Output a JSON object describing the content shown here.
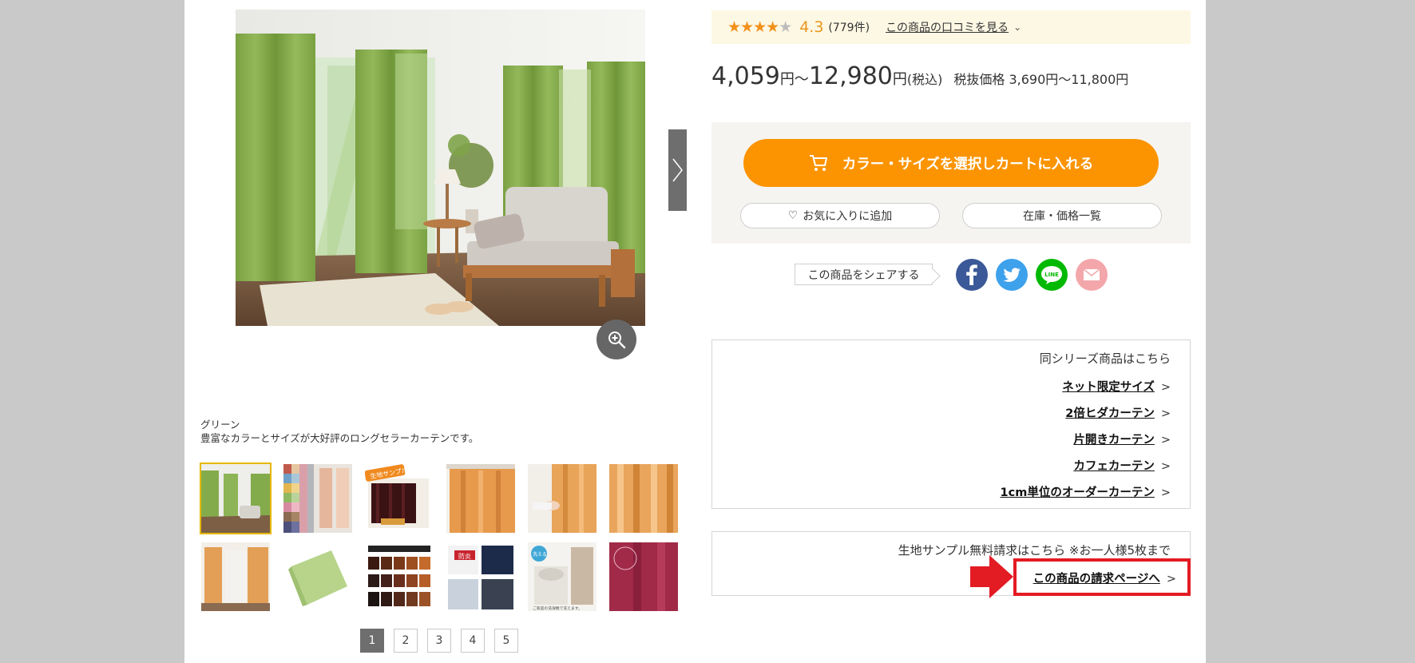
{
  "product": {
    "caption_color": "グリーン",
    "caption_desc": "豊富なカラーとサイズが大好評のロングセラーカーテンです。"
  },
  "rating": {
    "stars_filled": 4,
    "stars_total": 5,
    "score": "4.3",
    "count": "(779件)",
    "review_link": "この商品の口コミを見る",
    "star_color": "#f2911b"
  },
  "price": {
    "low": "4,059",
    "sep": "〜",
    "high": "12,980",
    "yen": "円",
    "tax_note": "(税込)",
    "ex_tax": "税抜価格 3,690円〜11,800円"
  },
  "cart": {
    "cart_button": "カラー・サイズを選択しカートに入れる",
    "favorite_button": "お気に入りに追加",
    "stock_button": "在庫・価格一覧",
    "accent": "#fb9400"
  },
  "share": {
    "label": "この商品をシェアする",
    "networks": [
      "facebook",
      "twitter",
      "line",
      "mail"
    ],
    "line_text": "LINE"
  },
  "series": {
    "title": "同シリーズ商品はこちら",
    "links": [
      "ネット限定サイズ",
      "2倍ヒダカーテン",
      "片開きカーテン",
      "カフェカーテン",
      "1cm単位のオーダーカーテン"
    ]
  },
  "sample": {
    "title": "生地サンプル無料請求はこちら ※お一人様5枚まで",
    "link": "この商品の請求ページへ",
    "highlight": "#e31b23"
  },
  "thumb_stamps": {
    "sample_badge": "生地サンプル",
    "protect_label": "防炎",
    "washable_badge": "洗える",
    "wash_note": "ご家庭の洗濯機で洗えます。"
  },
  "pagination": {
    "pages": [
      "1",
      "2",
      "3",
      "4",
      "5"
    ],
    "current": "1"
  },
  "thumbnails": [
    "green-room",
    "color-swatches",
    "dark-curtain-promo",
    "orange-pleat-closeup",
    "orange-curtain-hand",
    "orange-curtain-folds",
    "orange-room",
    "green-fabric-sample",
    "shading-grade-chart",
    "protection-comparison",
    "washable-curtain",
    "wine-fabric"
  ]
}
